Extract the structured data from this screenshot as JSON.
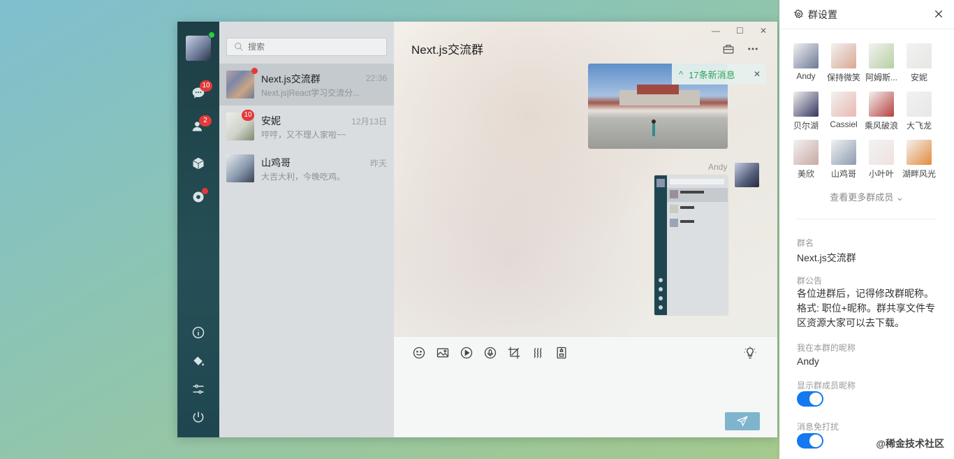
{
  "nav": {
    "badge_chat": "10",
    "badge_contacts": "2"
  },
  "search": {
    "placeholder": "搜索"
  },
  "chats": [
    {
      "name": "Next.js交流群",
      "time": "22:36",
      "preview": "Next.js|React学习交流分..."
    },
    {
      "name": "安妮",
      "time": "12月13日",
      "preview": "哼哼，又不理人家啦~~",
      "badge": "10"
    },
    {
      "name": "山鸡哥",
      "time": "昨天",
      "preview": "大吉大利，今晚吃鸡。"
    }
  ],
  "conversation": {
    "title": "Next.js交流群",
    "new_messages": "17条新消息",
    "sender": "Andy"
  },
  "panel": {
    "title": "群设置",
    "members": [
      {
        "name": "Andy",
        "color": "#6c7896"
      },
      {
        "name": "保持微笑",
        "color": "#d9a894"
      },
      {
        "name": "阿姆斯...",
        "color": "#b7d0a0"
      },
      {
        "name": "安妮",
        "color": "#e6e6e2"
      },
      {
        "name": "贝尔湖",
        "color": "#35355e"
      },
      {
        "name": "Cassiel",
        "color": "#e9b8b0"
      },
      {
        "name": "乘风破浪",
        "color": "#b8403e"
      },
      {
        "name": "大飞龙",
        "color": "#e7e7e7"
      },
      {
        "name": "美欣",
        "color": "#c9a8a4"
      },
      {
        "name": "山鸡哥",
        "color": "#8b9bb0"
      },
      {
        "name": "小叶叶",
        "color": "#efe2e0"
      },
      {
        "name": "湖畔风光",
        "color": "#e48a3a"
      }
    ],
    "more": "查看更多群成员",
    "group_name_label": "群名",
    "group_name": "Next.js交流群",
    "notice_label": "群公告",
    "notice": "各位进群后，记得修改群昵称。格式: 职位+昵称。群共享文件专区资源大家可以去下载。",
    "nickname_label": "我在本群的昵称",
    "nickname": "Andy",
    "show_nick_label": "显示群成员昵称",
    "show_nick_on": true,
    "dnd_label": "消息免打扰",
    "dnd_on": true
  },
  "watermark": "@稀金技术社区"
}
